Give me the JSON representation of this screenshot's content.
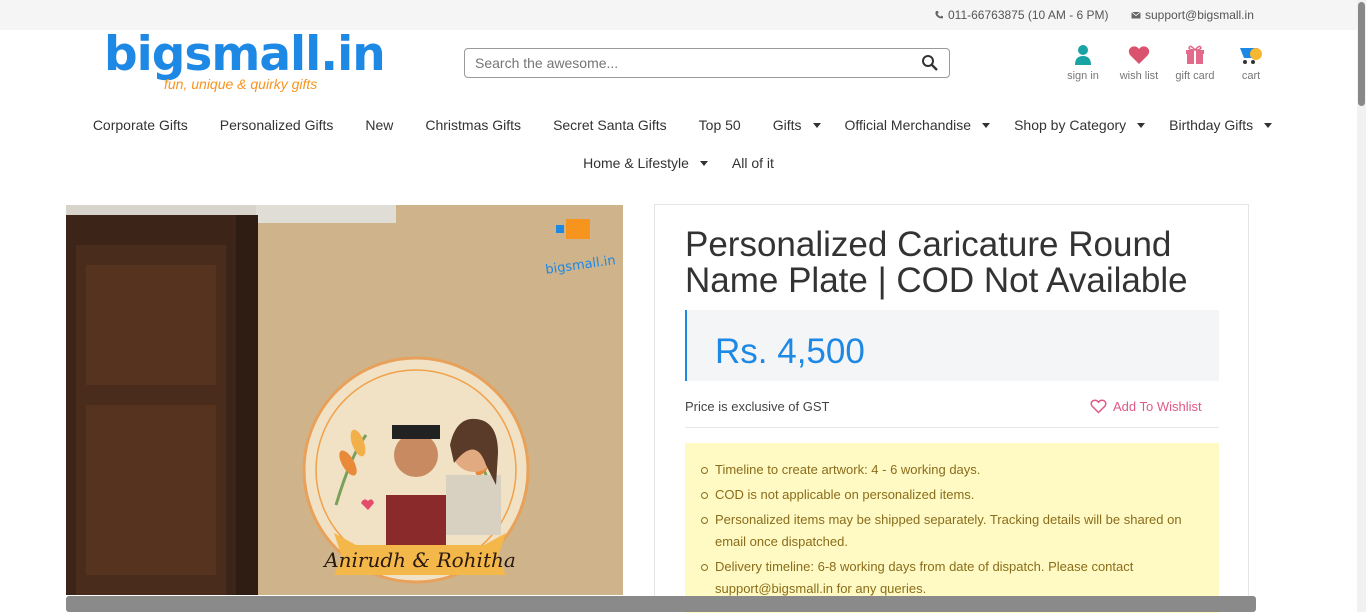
{
  "topbar": {
    "phone": "011-66763875 (10 AM - 6 PM)",
    "email": "support@bigsmall.in"
  },
  "logo": {
    "name": "bigsmall.in",
    "tagline": "fun, unique & quirky gifts"
  },
  "search": {
    "placeholder": "Search the awesome..."
  },
  "actions": {
    "sign_in": "sign in",
    "wish_list": "wish list",
    "gift_card": "gift card",
    "cart": "cart"
  },
  "nav": {
    "row1": [
      {
        "label": "Corporate Gifts",
        "dropdown": false
      },
      {
        "label": "Personalized Gifts",
        "dropdown": false
      },
      {
        "label": "New",
        "dropdown": false
      },
      {
        "label": "Christmas Gifts",
        "dropdown": false
      },
      {
        "label": "Secret Santa Gifts",
        "dropdown": false
      },
      {
        "label": "Top 50",
        "dropdown": false
      },
      {
        "label": "Gifts",
        "dropdown": true
      },
      {
        "label": "Official Merchandise",
        "dropdown": true
      },
      {
        "label": "Shop by Category",
        "dropdown": true
      },
      {
        "label": "Birthday Gifts",
        "dropdown": true
      }
    ],
    "row2": [
      {
        "label": "Home & Lifestyle",
        "dropdown": true
      },
      {
        "label": "All of it",
        "dropdown": false
      }
    ]
  },
  "product": {
    "title": "Personalized Caricature Round Name Plate | COD Not Available",
    "price": "Rs. 4,500",
    "gst_note": "Price is exclusive of GST",
    "wishlist_label": "Add To Wishlist",
    "image_text": "Anirudh & Rohitha",
    "image_watermark": "bigsmall.in",
    "notes": [
      "Timeline to create artwork: 4 - 6 working days.",
      "COD is not applicable on personalized items.",
      "Personalized items may be shipped separately. Tracking details will be shared on email once dispatched.",
      "Delivery timeline: 6-8 working days from date of dispatch. Please contact support@bigsmall.in for any queries."
    ]
  },
  "colors": {
    "brand_blue": "#1e88e5",
    "brand_orange": "#f7941d",
    "wishlist_pink": "#e05a84",
    "note_bg": "#fff9c4"
  }
}
